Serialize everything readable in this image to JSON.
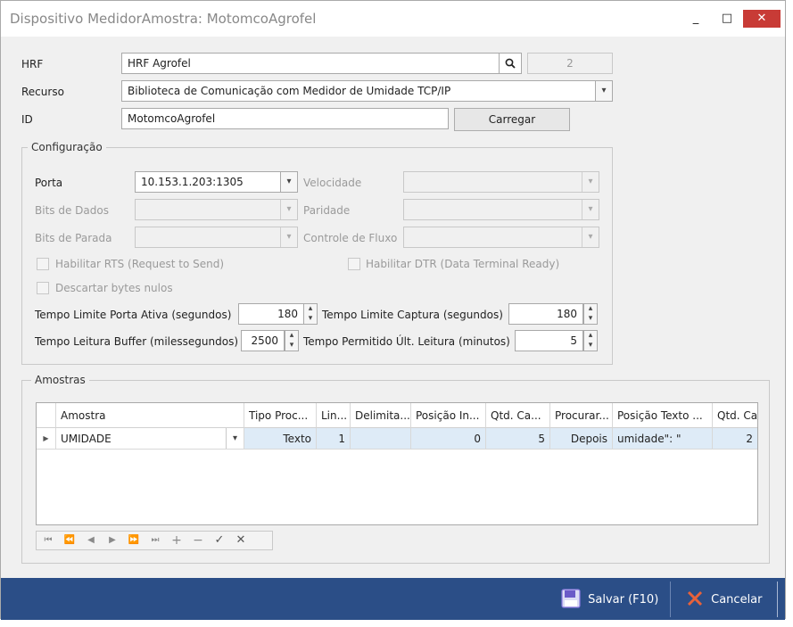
{
  "window": {
    "title": "Dispositivo MedidorAmostra: MotomcoAgrofel",
    "minimize": "_",
    "maximize": "□",
    "close": "✕"
  },
  "form": {
    "hrf_label": "HRF",
    "hrf_value": "HRF Agrofel",
    "hrf_code": "2",
    "recurso_label": "Recurso",
    "recurso_value": "Biblioteca de Comunicação com Medidor de Umidade TCP/IP",
    "id_label": "ID",
    "id_value": "MotomcoAgrofel",
    "carregar_label": "Carregar"
  },
  "config": {
    "title": "Configuração",
    "porta_label": "Porta",
    "porta_value": "10.153.1.203:1305",
    "velocidade_label": "Velocidade",
    "bits_dados_label": "Bits de Dados",
    "paridade_label": "Paridade",
    "bits_parada_label": "Bits de Parada",
    "controle_fluxo_label": "Controle de Fluxo",
    "rts_label": "Habilitar RTS (Request to Send)",
    "dtr_label": "Habilitar DTR (Data Terminal Ready)",
    "descartar_label": "Descartar bytes nulos",
    "tempo_porta_label": "Tempo Limite Porta Ativa (segundos)",
    "tempo_porta_value": "180",
    "tempo_captura_label": "Tempo Limite Captura (segundos)",
    "tempo_captura_value": "180",
    "tempo_buffer_label": "Tempo Leitura Buffer (milessegundos)",
    "tempo_buffer_value": "2500",
    "tempo_ultima_label": "Tempo Permitido Últ. Leitura (minutos)",
    "tempo_ultima_value": "5"
  },
  "amostras": {
    "title": "Amostras",
    "columns": [
      "Amostra",
      "Tipo Proc...",
      "Lin...",
      "Delimita...",
      "Posição In...",
      "Qtd. Ca...",
      "Procurar...",
      "Posição Texto ...",
      "Qtd. Casas..."
    ],
    "row": {
      "amostra": "UMIDADE",
      "tipo": "Texto",
      "linha": "1",
      "delimitador": "",
      "posicao_inicial": "0",
      "qtd_caracteres": "5",
      "procurar": "Depois",
      "posicao_texto": "umidade\": \"",
      "qtd_casas": "2"
    },
    "nav": [
      "⏮",
      "⏪",
      "◀",
      "▶",
      "⏩",
      "⏭",
      "+",
      "−",
      "✓",
      "✕"
    ]
  },
  "footer": {
    "salvar_label": "Salvar (F10)",
    "cancelar_label": "Cancelar"
  },
  "colors": {
    "footer": "#2b4e87",
    "close_button": "#c83b36",
    "selected_row": "#deebf7"
  }
}
